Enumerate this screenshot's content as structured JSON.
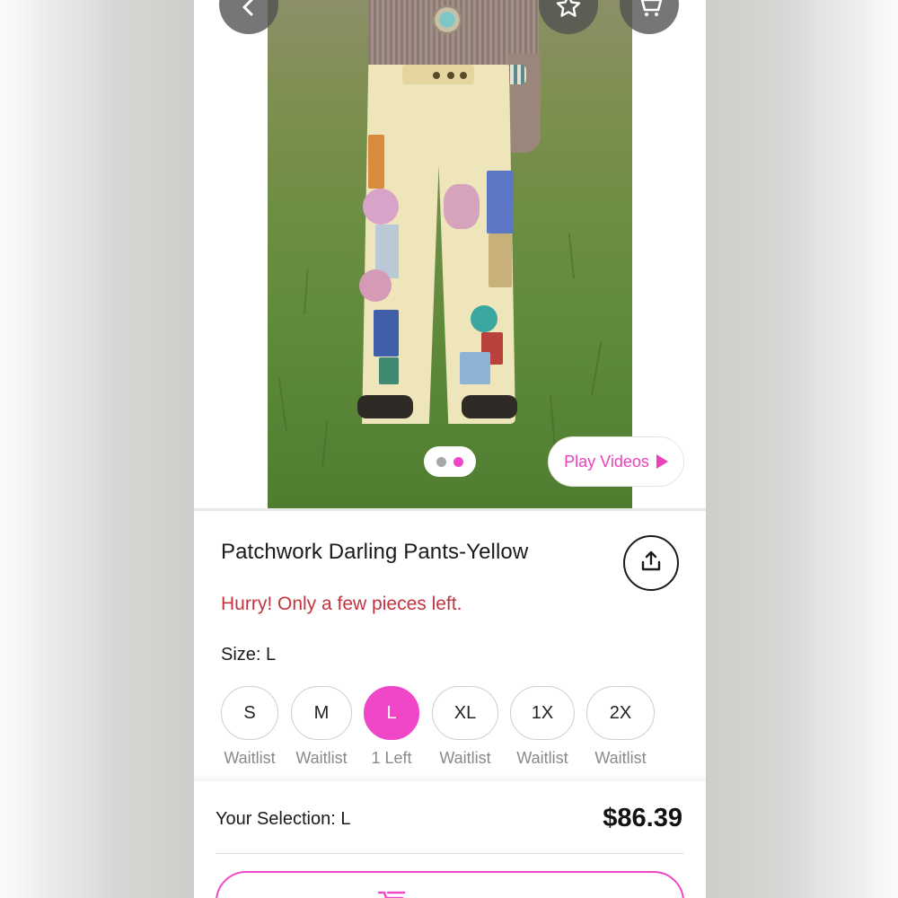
{
  "nav": {
    "back_icon": "chevron-left-icon",
    "favorite_icon": "star-icon",
    "cart_icon": "cart-icon"
  },
  "gallery": {
    "indicator_count": 2,
    "active_index": 1,
    "play_videos_label": "Play Videos"
  },
  "product": {
    "title": "Patchwork Darling Pants-Yellow",
    "urgency": "Hurry! Only a few pieces left.",
    "size_label": "Size: L",
    "sizes": [
      {
        "label": "S",
        "status": "Waitlist",
        "selected": false
      },
      {
        "label": "M",
        "status": "Waitlist",
        "selected": false
      },
      {
        "label": "L",
        "status": "1 Left",
        "selected": true
      },
      {
        "label": "XL",
        "status": "Waitlist",
        "selected": false
      },
      {
        "label": "1X",
        "status": "Waitlist",
        "selected": false
      },
      {
        "label": "2X",
        "status": "Waitlist",
        "selected": false
      }
    ]
  },
  "selection": {
    "label": "Your Selection: L",
    "price": "$86.39"
  },
  "colors": {
    "accent": "#f047c9",
    "urgency": "#c4343f",
    "text": "#1a1a1a",
    "muted": "#8a8a8a"
  }
}
